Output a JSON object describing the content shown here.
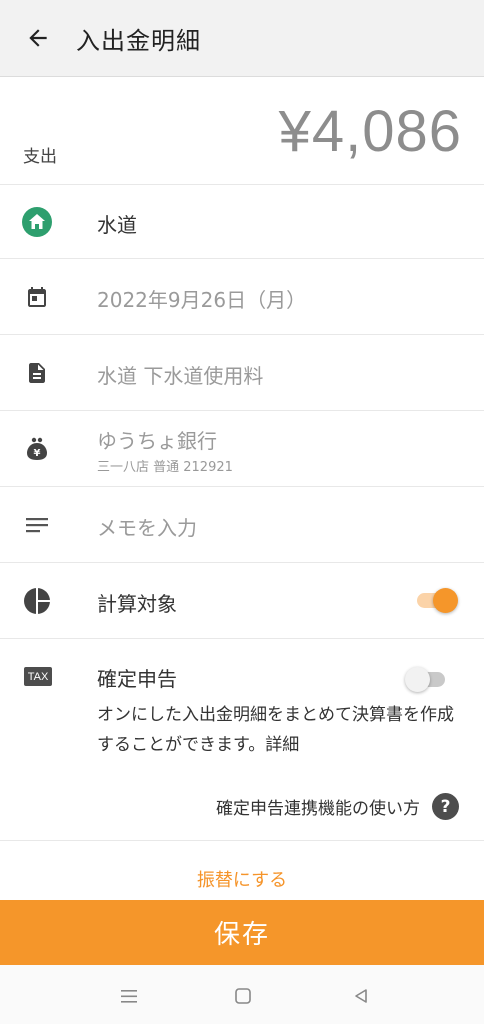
{
  "header": {
    "title": "入出金明細"
  },
  "amount": {
    "label": "支出",
    "value": "¥4,086"
  },
  "category": {
    "name": "水道",
    "icon": "house-icon",
    "icon_color": "#2e9f6e"
  },
  "date": {
    "value": "2022年9月26日（月）",
    "icon": "calendar-icon"
  },
  "description": {
    "value": "水道 下水道使用料",
    "icon": "document-icon"
  },
  "account": {
    "name": "ゆうちょ銀行",
    "detail": "三一八店 普通 212921",
    "icon": "wallet-yen-icon"
  },
  "memo": {
    "placeholder": "メモを入力",
    "icon": "lines-icon"
  },
  "calculation": {
    "label": "計算対象",
    "enabled": true,
    "icon": "pie-chart-icon"
  },
  "tax_return": {
    "badge": "TAX",
    "label": "確定申告",
    "enabled": false,
    "description": "オンにした入出金明細をまとめて決算書を作成することができます。詳細"
  },
  "help": {
    "label": "確定申告連携機能の使い方",
    "icon": "question-icon"
  },
  "transfer_link": "振替にする",
  "save_button": "保存",
  "colors": {
    "accent": "#f5962a",
    "toggle_track_on": "#fbd3a8",
    "toggle_off_knob": "#f2f2f2",
    "toggle_off_track": "#c9c9c9"
  }
}
